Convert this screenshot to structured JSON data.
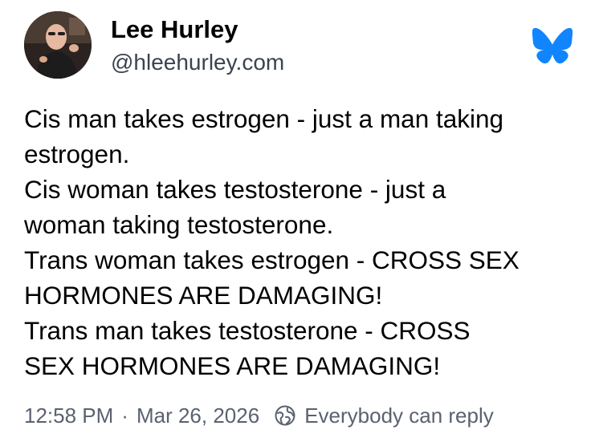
{
  "author": {
    "display_name": "Lee Hurley",
    "handle": "@hleehurley.com"
  },
  "post": {
    "lines": [
      "Cis man takes estrogen - just a man taking",
      "estrogen.",
      "Cis woman takes testosterone - just a",
      "woman taking testosterone.",
      "Trans woman takes estrogen - CROSS SEX",
      "HORMONES ARE DAMAGING!",
      "Trans man takes testosterone - CROSS",
      "SEX HORMONES ARE DAMAGING!"
    ]
  },
  "meta": {
    "time": "12:58 PM",
    "separator": "·",
    "date": "Mar 26, 2026",
    "reply_setting": "Everybody can reply",
    "reply_icon": "globe-reply-icon"
  },
  "brand": {
    "icon": "bluesky-butterfly-icon",
    "color": "#1185fe"
  },
  "colors": {
    "text": "#000000",
    "secondary_text": "#5a6170",
    "background": "#ffffff"
  }
}
